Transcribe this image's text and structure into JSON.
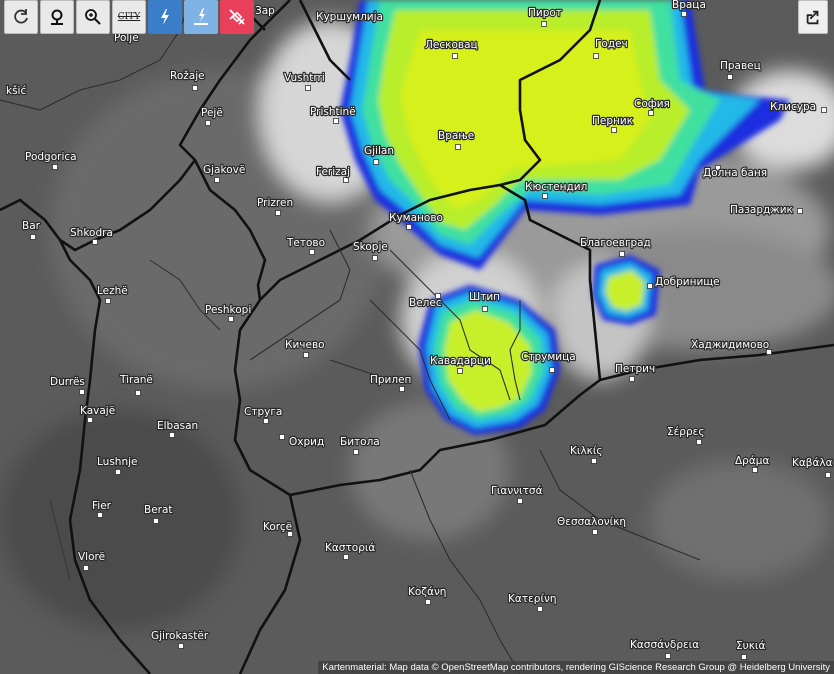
{
  "toolbar": {
    "buttons": [
      {
        "name": "refresh-button",
        "icon": "refresh-icon"
      },
      {
        "name": "location-button",
        "icon": "map-pin-icon"
      },
      {
        "name": "zoom-button",
        "icon": "zoom-in-icon"
      },
      {
        "name": "city-labels-button",
        "icon": "city-icon",
        "label": "CITY"
      },
      {
        "name": "lightning-button",
        "icon": "lightning-icon"
      },
      {
        "name": "ground-strike-button",
        "icon": "ground-strike-icon"
      },
      {
        "name": "no-satellite-button",
        "icon": "satellite-off-icon"
      }
    ]
  },
  "share": {
    "icon": "share-icon"
  },
  "attribution": "Kartenmaterial: Map data © OpenStreetMap contributors, rendering GIScience Research Group @ Heidelberg University",
  "colors": {
    "radar_low": "#1a2de0",
    "radar_mid": "#21b8e8",
    "radar_high": "#d6f01a",
    "border": "#111111",
    "background": "#5b5b5b"
  },
  "places": [
    {
      "name": "Куршумлија"
    },
    {
      "name": "Пирот"
    },
    {
      "name": "Враца"
    },
    {
      "name": "Лесковац"
    },
    {
      "name": "Годеч"
    },
    {
      "name": "Правец"
    },
    {
      "name": "София"
    },
    {
      "name": "Клисура"
    },
    {
      "name": "Перник"
    },
    {
      "name": "Врање"
    },
    {
      "name": "Vushtrri"
    },
    {
      "name": "Rožaje"
    },
    {
      "name": "Pejë"
    },
    {
      "name": "Prishtinë"
    },
    {
      "name": "Gjilan"
    },
    {
      "name": "Podgorica"
    },
    {
      "name": "Gjakovë"
    },
    {
      "name": "Ferizaj"
    },
    {
      "name": "Prizren"
    },
    {
      "name": "Кюстендил"
    },
    {
      "name": "Долна баня"
    },
    {
      "name": "Пазарджик"
    },
    {
      "name": "Bar"
    },
    {
      "name": "Shkodra"
    },
    {
      "name": "Куманово"
    },
    {
      "name": "Тетово"
    },
    {
      "name": "Skopje"
    },
    {
      "name": "Благоевград"
    },
    {
      "name": "Lezhë"
    },
    {
      "name": "Велес"
    },
    {
      "name": "Штип"
    },
    {
      "name": "Добринище"
    },
    {
      "name": "Peshkopi"
    },
    {
      "name": "Кичево"
    },
    {
      "name": "Кавадарци"
    },
    {
      "name": "Струмица"
    },
    {
      "name": "Хаджидимово"
    },
    {
      "name": "Durrës"
    },
    {
      "name": "Tiranë"
    },
    {
      "name": "Прилеп"
    },
    {
      "name": "Петрич"
    },
    {
      "name": "Kavajë"
    },
    {
      "name": "Струга"
    },
    {
      "name": "Elbasan"
    },
    {
      "name": "Охрид"
    },
    {
      "name": "Битола"
    },
    {
      "name": "Σέρρες"
    },
    {
      "name": "Κιλκίς"
    },
    {
      "name": "Lushnje"
    },
    {
      "name": "Δράμα"
    },
    {
      "name": "Καβάλα"
    },
    {
      "name": "Γιαννιτσά"
    },
    {
      "name": "Fier"
    },
    {
      "name": "Berat"
    },
    {
      "name": "Θεσσαλονίκη"
    },
    {
      "name": "Korçë"
    },
    {
      "name": "Vlorë"
    },
    {
      "name": "Καστοριά"
    },
    {
      "name": "Κοζάνη"
    },
    {
      "name": "Κατερίνη"
    },
    {
      "name": "Gjirokastër"
    },
    {
      "name": "Κασσάνδρεια"
    },
    {
      "name": "Συκιά"
    },
    {
      "name": "Polje"
    },
    {
      "name": "kšić"
    },
    {
      "name": "Зар"
    }
  ]
}
